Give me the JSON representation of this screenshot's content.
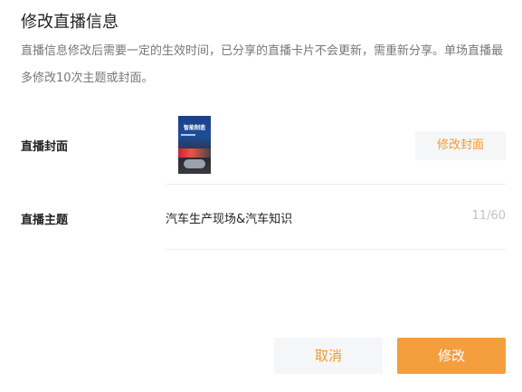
{
  "dialog": {
    "title": "修改直播信息",
    "description": "直播信息修改后需要一定的生效时间，已分享的直播卡片不会更新，需重新分享。单场直播最多修改10次主题或封面。"
  },
  "cover": {
    "label": "直播封面",
    "thumbnail_text": "智能制造",
    "edit_button": "修改封面"
  },
  "topic": {
    "label": "直播主题",
    "value": "汽车生产现场&汽车知识",
    "counter": "11/60"
  },
  "footer": {
    "cancel_label": "取消",
    "submit_label": "修改"
  },
  "colors": {
    "accent": "#f59e3d",
    "accent_text": "#f39a2d",
    "muted_bg": "#f5f6f7"
  }
}
